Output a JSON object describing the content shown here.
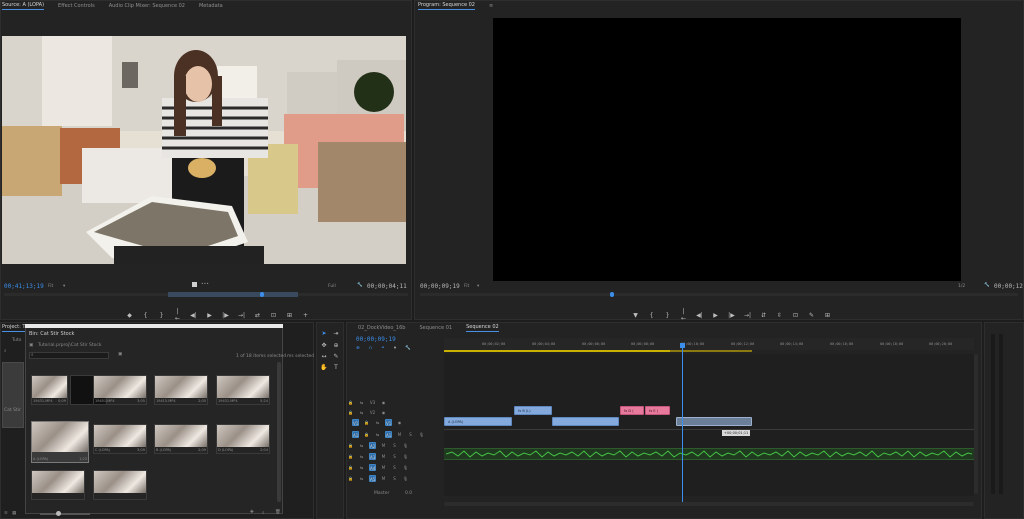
{
  "source_monitor": {
    "tabs": [
      "Source: A (LOPA)",
      "Effect Controls",
      "Audio Clip Mixer: Sequence 02",
      "Metadata"
    ],
    "timecode_left": "00;41;13;19",
    "fit": "Fit",
    "quality": "Full",
    "timecode_right": "00;00;04;11",
    "transport": [
      "◆",
      "{",
      "}",
      "|←",
      "◀|",
      "▶",
      "|▶",
      "→|",
      "⇄",
      "⊡",
      "⊞",
      "+"
    ]
  },
  "program_monitor": {
    "tab": "Program: Sequence 02",
    "timecode_left": "00;00;09;19",
    "fit": "Fit",
    "zoom": "1/2",
    "timecode_right": "00;00;12",
    "transport": [
      "▼",
      "{",
      "}",
      "|←",
      "◀|",
      "▶",
      "|▶",
      "→|",
      "⇵",
      "⇳",
      "⊡",
      "✎",
      "⊞"
    ]
  },
  "project_panel": {
    "tab_project": "Project: Tu",
    "tab_bin": "Bin: Cat Stir Stock",
    "path": "Tutorial.prproj\\Cat Stir Stock",
    "items_selected": "1 of 18 items selected",
    "side_label_1": "Tuto",
    "side_label_2": "Cat Stir",
    "more_label": "ms selected",
    "thumbs": [
      {
        "name": "19431.MP4",
        "dur": "0;09"
      },
      {
        "name": "",
        "dur": ""
      },
      {
        "name": "19451.MP4",
        "dur": "3;05"
      },
      {
        "name": "19415.MP4",
        "dur": "2;05"
      },
      {
        "name": "19431.MP4",
        "dur": "5;24"
      },
      {
        "name": "19437.MP4",
        "dur": "3;24"
      },
      {
        "name": "A (LOPA)",
        "dur": "1;23"
      },
      {
        "name": "C (LOPA)",
        "dur": "3;09"
      },
      {
        "name": "B (LOPA)",
        "dur": "2;09"
      },
      {
        "name": "D (LOPA)",
        "dur": "2;04"
      },
      {
        "name": "",
        "dur": ""
      },
      {
        "name": "",
        "dur": ""
      }
    ]
  },
  "timeline": {
    "tabs": [
      "02_DockVideo_16b",
      "Sequence 01",
      "Sequence 02"
    ],
    "timecode": "00;00;09;19",
    "ruler": [
      "00;00;02;00",
      "00;00;04;00",
      "00;00;06;00",
      "00;00;08;00",
      "00;00;10;00",
      "00;00;12;00",
      "00;00;14;00",
      "00;00;16;00",
      "00;00;18;00",
      "00;00;20;00"
    ],
    "clips": {
      "v1_a": "A (LOPA)",
      "v2_a": "fx B (L)",
      "v1_b": "C (LOPA)",
      "v2_pink_1": "fx D (",
      "v2_pink_2": "fx E (",
      "v1_ghost": "",
      "tooltip": "+00;00;01;11"
    },
    "master_label": "Master",
    "master_value": "0.0"
  }
}
